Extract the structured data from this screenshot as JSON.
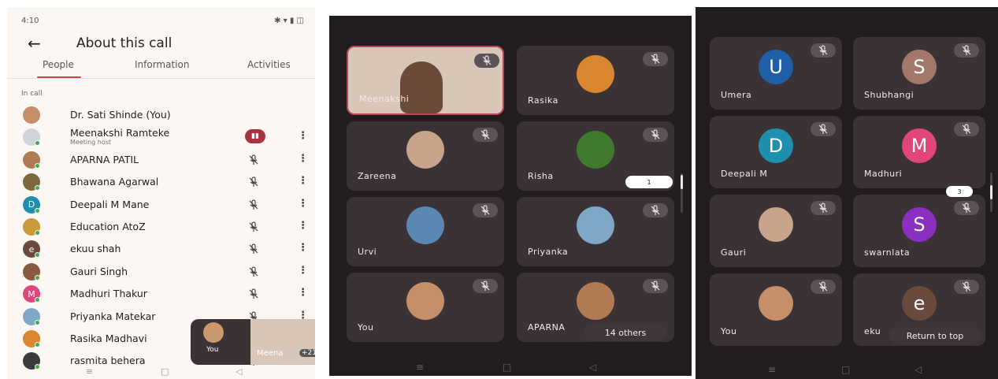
{
  "panel1": {
    "status_time": "4:10",
    "status_right": "✱ ▾ ▮ ◫",
    "back_label": "←",
    "title": "About this call",
    "tabs": [
      "People",
      "Information",
      "Activities"
    ],
    "section_label": "In call",
    "participants": [
      {
        "name": "Dr. Sati Shinde (You)",
        "sub": "",
        "initial": "",
        "color": "#c58f6a",
        "mic": "none"
      },
      {
        "name": "Meenakshi Ramteke",
        "sub": "Meeting host",
        "initial": "",
        "color": "#cfd4dc",
        "mic": "presenting"
      },
      {
        "name": "APARNA PATIL",
        "sub": "",
        "initial": "",
        "color": "#b07a52",
        "mic": "off"
      },
      {
        "name": "Bhawana Agarwal",
        "sub": "",
        "initial": "",
        "color": "#7a6a3e",
        "mic": "off"
      },
      {
        "name": "Deepali M Mane",
        "sub": "",
        "initial": "D",
        "color": "#1f8fb0",
        "mic": "off"
      },
      {
        "name": "Education AtoZ",
        "sub": "",
        "initial": "",
        "color": "#c99a3a",
        "mic": "off"
      },
      {
        "name": "ekuu shah",
        "sub": "",
        "initial": "e",
        "color": "#6a4a3c",
        "mic": "off"
      },
      {
        "name": "Gauri Singh",
        "sub": "",
        "initial": "",
        "color": "#8a5a40",
        "mic": "off"
      },
      {
        "name": "Madhuri Thakur",
        "sub": "",
        "initial": "M",
        "color": "#e0457b",
        "mic": "off"
      },
      {
        "name": "Priyanka Matekar",
        "sub": "",
        "initial": "",
        "color": "#7fa8c8",
        "mic": "off"
      },
      {
        "name": "Rasika Madhavi",
        "sub": "",
        "initial": "",
        "color": "#d9862e",
        "mic": "off"
      },
      {
        "name": "rasmita behera",
        "sub": "",
        "initial": "",
        "color": "#3b3b3b",
        "mic": "off"
      }
    ],
    "more_icon": "⋮",
    "pip": {
      "you_label": "You",
      "video_label": "Meena",
      "badge": "+21"
    },
    "nav": [
      "≡",
      "□",
      "◁"
    ]
  },
  "panel2": {
    "tiles": [
      {
        "label": "Meenakshi",
        "kind": "video",
        "color": "#d8c6b8",
        "initial": ""
      },
      {
        "label": "Rasika",
        "kind": "avatar",
        "color": "#d9862e",
        "initial": ""
      },
      {
        "label": "Zareena",
        "kind": "avatar",
        "color": "#c7a48a",
        "initial": ""
      },
      {
        "label": "Risha",
        "kind": "avatar",
        "color": "#3f7a2e",
        "initial": ""
      },
      {
        "label": "Urvi",
        "kind": "avatar",
        "color": "#5b88b3",
        "initial": ""
      },
      {
        "label": "Priyanka",
        "kind": "avatar",
        "color": "#7fa8c8",
        "initial": ""
      },
      {
        "label": "You",
        "kind": "avatar",
        "color": "#c58f6a",
        "initial": ""
      },
      {
        "label": "APARNA",
        "kind": "avatar",
        "color": "#b07a52",
        "initial": ""
      }
    ],
    "page_chip": "1",
    "others_label": "14 others",
    "nav": [
      "≡",
      "□",
      "◁"
    ]
  },
  "panel3": {
    "tiles": [
      {
        "label": "Umera",
        "kind": "letter",
        "color": "#1f5fa8",
        "initial": "U"
      },
      {
        "label": "Shubhangi",
        "kind": "letter",
        "color": "#a3776a",
        "initial": "S"
      },
      {
        "label": "Deepali M",
        "kind": "letter",
        "color": "#1f8fb0",
        "initial": "D"
      },
      {
        "label": "Madhuri",
        "kind": "letter",
        "color": "#e0457b",
        "initial": "M"
      },
      {
        "label": "Gauri",
        "kind": "avatar",
        "color": "#c7a48a",
        "initial": ""
      },
      {
        "label": "swarnlata",
        "kind": "letter",
        "color": "#8a2fc0",
        "initial": "S"
      },
      {
        "label": "You",
        "kind": "avatar",
        "color": "#c58f6a",
        "initial": ""
      },
      {
        "label": "eku",
        "kind": "letter",
        "color": "#6a4a3c",
        "initial": "e"
      }
    ],
    "page_chip": "3",
    "return_label": "Return to top",
    "nav": [
      "≡",
      "□",
      "◁"
    ]
  }
}
